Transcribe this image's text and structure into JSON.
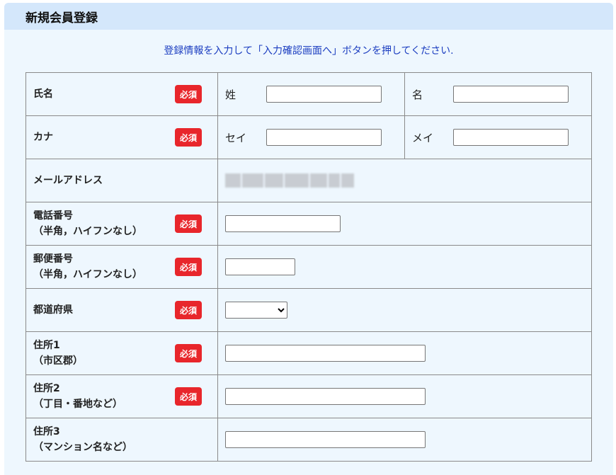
{
  "header": {
    "title": "新規会員登録"
  },
  "instruction": "登録情報を入力して「入力確認画面へ」ボタンを押してください.",
  "required_label": "必須",
  "rows": {
    "name": {
      "label": "氏名",
      "sub1_label": "姓",
      "sub1_value": "",
      "sub2_label": "名",
      "sub2_value": ""
    },
    "kana": {
      "label": "カナ",
      "sub1_label": "セイ",
      "sub1_value": "",
      "sub2_label": "メイ",
      "sub2_value": ""
    },
    "email": {
      "label": "メールアドレス"
    },
    "phone": {
      "label_line1": "電話番号",
      "label_line2": "（半角，ハイフンなし）",
      "value": ""
    },
    "zip": {
      "label_line1": "郵便番号",
      "label_line2": "（半角，ハイフンなし）",
      "value": ""
    },
    "prefecture": {
      "label": "都道府県",
      "selected": ""
    },
    "address1": {
      "label_line1": "住所1",
      "label_line2": "（市区郡）",
      "value": ""
    },
    "address2": {
      "label_line1": "住所2",
      "label_line2": "（丁目・番地など）",
      "value": ""
    },
    "address3": {
      "label_line1": "住所3",
      "label_line2": "（マンション名など）",
      "value": ""
    }
  },
  "colors": {
    "badge": "#e8262b",
    "header_bg": "#d4e7fb",
    "panel_bg": "#eef7fe",
    "instruction_text": "#1a3cc0"
  }
}
